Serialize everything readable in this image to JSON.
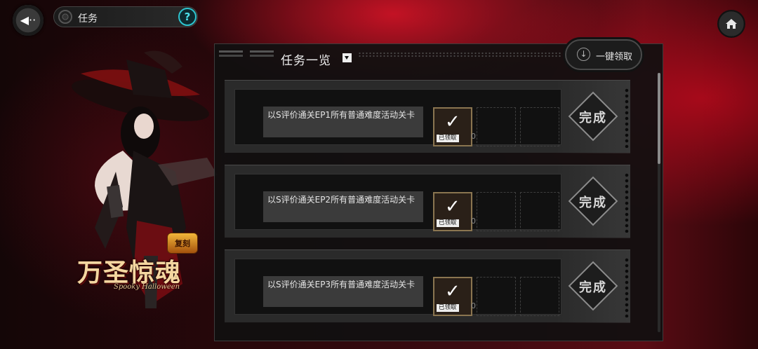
{
  "header": {
    "title": "任务",
    "back_icon": "back-arrow-icon",
    "help_label": "?",
    "home_icon": "home-icon"
  },
  "event_logo": {
    "badge": "复刻",
    "title": "万圣惊魂",
    "subtitle": "Spooky Halloween"
  },
  "panel": {
    "title": "任务一览",
    "claim_all_label": "一键领取"
  },
  "tasks": [
    {
      "desc": "以S评价通关EP1所有普通难度活动关卡",
      "claimed_label": "已领取",
      "count": "0",
      "status": "完成"
    },
    {
      "desc": "以S评价通关EP2所有普通难度活动关卡",
      "claimed_label": "已领取",
      "count": "0",
      "status": "完成"
    },
    {
      "desc": "以S评价通关EP3所有普通难度活动关卡",
      "claimed_label": "已领取",
      "count": "0",
      "status": "完成"
    }
  ],
  "colors": {
    "accent_red": "#b0101e",
    "help_cyan": "#2ec4cf",
    "panel_bg": "#101010"
  }
}
